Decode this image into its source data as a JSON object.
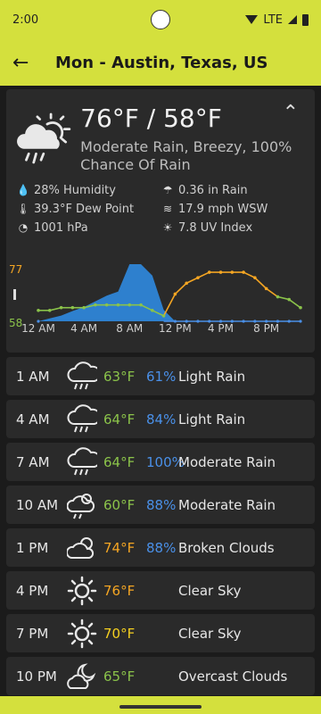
{
  "status": {
    "time": "2:00",
    "network": "LTE"
  },
  "appbar": {
    "title": "Mon - Austin, Texas, US"
  },
  "current": {
    "temp": "76°F / 58°F",
    "desc": "Moderate Rain, Breezy, 100% Chance Of Rain",
    "humidity": "28% Humidity",
    "rain": "0.36 in Rain",
    "dew_point": "39.3°F Dew Point",
    "wind": "17.9 mph WSW",
    "pressure": "1001 hPa",
    "uv": "7.8 UV Index"
  },
  "chart_data": {
    "type": "line",
    "y_max_label": "77",
    "y_min_label": "58",
    "x_tick_labels": [
      "12 AM",
      "4 AM",
      "8 AM",
      "12 PM",
      "4 PM",
      "8 PM"
    ],
    "hours": [
      0,
      1,
      2,
      3,
      4,
      5,
      6,
      7,
      8,
      9,
      10,
      11,
      12,
      13,
      14,
      15,
      16,
      17,
      18,
      19,
      20,
      21,
      22,
      23
    ],
    "series": [
      {
        "values": [
          62,
          62,
          63,
          63,
          63,
          64,
          64,
          64,
          64,
          64,
          62,
          60,
          68,
          72,
          74,
          76,
          76,
          76,
          76,
          74,
          70,
          67,
          66,
          63
        ],
        "color": "#8bc34a",
        "warm_color": "#f5a623"
      },
      {
        "values": [
          0,
          5,
          10,
          18,
          25,
          35,
          45,
          52,
          100,
          100,
          80,
          20,
          0,
          0,
          0,
          0,
          0,
          0,
          0,
          0,
          0,
          0,
          0,
          0
        ],
        "color": "#4a90e8"
      }
    ],
    "colors": {
      "rain_area": "#2f8ae0",
      "grid": "#4a4a4a"
    }
  },
  "hourly": [
    {
      "time": "1 AM",
      "icon": "rain-cloud-icon",
      "temp": "63°F",
      "temp_color": "#8bc34a",
      "pop": "61%",
      "desc": "Light Rain"
    },
    {
      "time": "4 AM",
      "icon": "rain-cloud-icon",
      "temp": "64°F",
      "temp_color": "#8bc34a",
      "pop": "84%",
      "desc": "Light Rain"
    },
    {
      "time": "7 AM",
      "icon": "rain-cloud-icon",
      "temp": "64°F",
      "temp_color": "#8bc34a",
      "pop": "100%",
      "desc": "Moderate Rain"
    },
    {
      "time": "10 AM",
      "icon": "sun-rain-cloud-icon",
      "temp": "60°F",
      "temp_color": "#8bc34a",
      "pop": "88%",
      "desc": "Moderate Rain"
    },
    {
      "time": "1 PM",
      "icon": "partly-cloudy-icon",
      "temp": "74°F",
      "temp_color": "#f5a623",
      "pop": "88%",
      "desc": "Broken Clouds"
    },
    {
      "time": "4 PM",
      "icon": "sun-icon",
      "temp": "76°F",
      "temp_color": "#f5a623",
      "pop": "",
      "desc": "Clear Sky"
    },
    {
      "time": "7 PM",
      "icon": "sun-icon",
      "temp": "70°F",
      "temp_color": "#f5d020",
      "pop": "",
      "desc": "Clear Sky"
    },
    {
      "time": "10 PM",
      "icon": "moon-cloud-icon",
      "temp": "65°F",
      "temp_color": "#8bc34a",
      "pop": "",
      "desc": "Overcast Clouds"
    }
  ]
}
